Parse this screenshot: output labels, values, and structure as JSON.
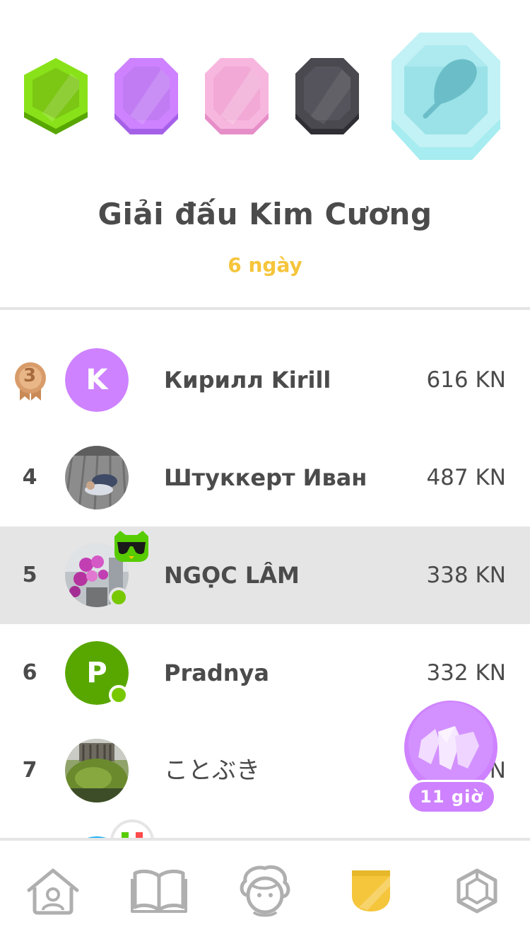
{
  "league": {
    "title": "Giải đấu Kim Cương",
    "days_left": "6 ngày",
    "icons": [
      "green-league-icon",
      "purple-league-icon",
      "pink-league-icon",
      "dark-league-icon",
      "diamond-league-icon"
    ]
  },
  "leaderboard": [
    {
      "rank": "3",
      "medal": "bronze",
      "name": "Кирилл Kirill",
      "xp": "616 KN",
      "avatar_letter": "K",
      "avatar_color": "#ce82ff",
      "online": false,
      "current": false
    },
    {
      "rank": "4",
      "name": "Штуккерт Иван",
      "xp": "487 KN",
      "avatar": "photo-wooden-deck",
      "online": false,
      "current": false
    },
    {
      "rank": "5",
      "name": "NGỌC LÂM",
      "xp": "338 KN",
      "avatar": "photo-orchid",
      "online": true,
      "current": true,
      "badge": "owl-sunglasses-icon"
    },
    {
      "rank": "6",
      "name": "Pradnya",
      "xp": "332 KN",
      "avatar_letter": "P",
      "avatar_color": "#58a700",
      "online": true,
      "current": false
    },
    {
      "rank": "7",
      "name": "ことぶき",
      "xp": "",
      "avatar": "photo-mossy-ruin",
      "online": false,
      "current": false
    }
  ],
  "chest": {
    "timer": "11 giờ",
    "icon": "crystal-chest-icon"
  },
  "tabs": [
    {
      "name": "home-icon",
      "active": false
    },
    {
      "name": "book-icon",
      "active": false
    },
    {
      "name": "character-icon",
      "active": false
    },
    {
      "name": "shield-icon",
      "active": true
    },
    {
      "name": "hexagon-icon",
      "active": false
    }
  ],
  "colors": {
    "accent_yellow": "#f5c53b",
    "current_row": "#e5e5e5",
    "online_green": "#78c800",
    "purple": "#ce82ff"
  }
}
